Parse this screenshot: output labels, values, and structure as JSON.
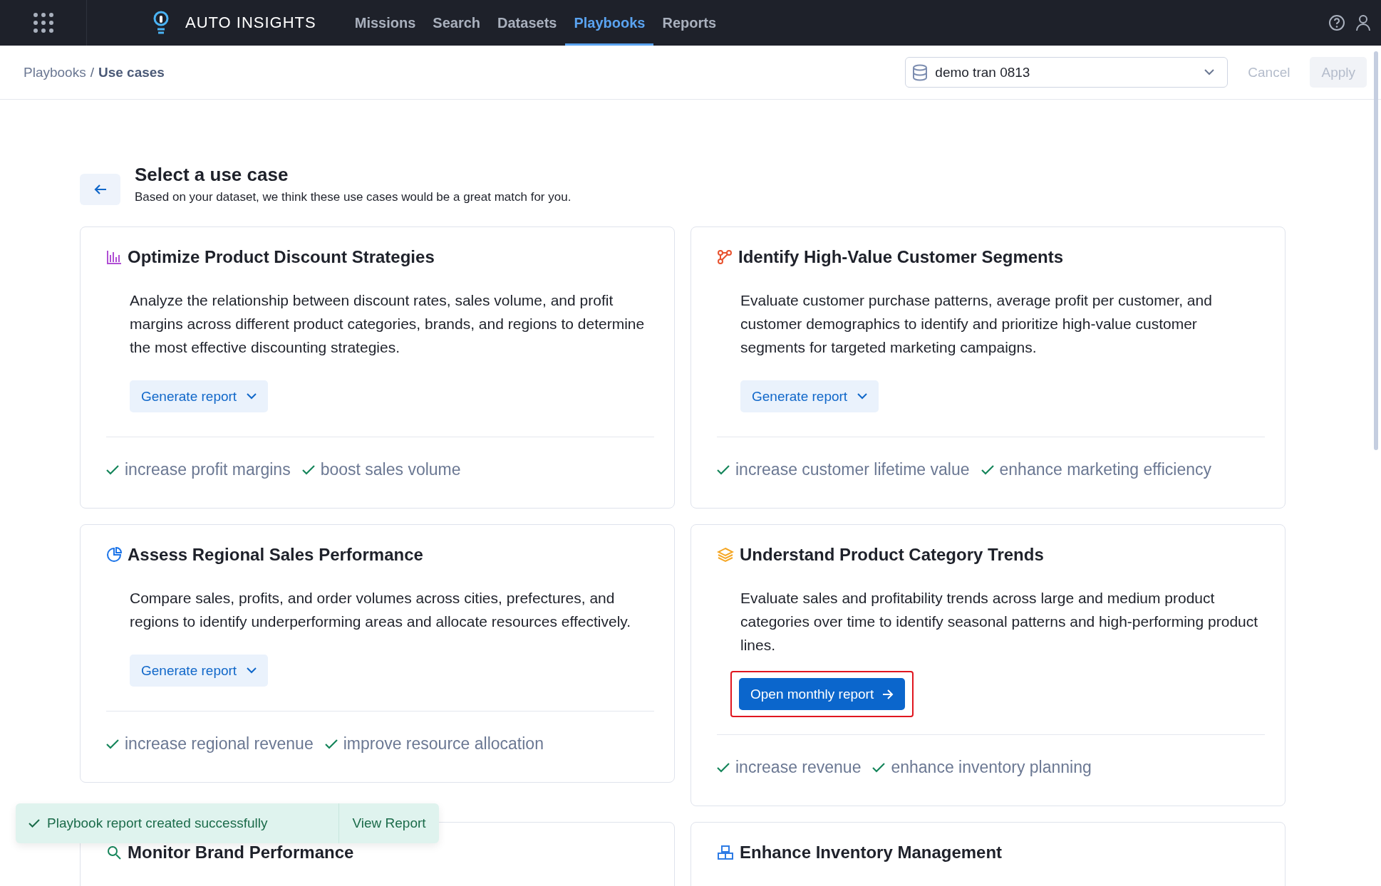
{
  "topbar": {
    "brand": "AUTO INSIGHTS",
    "nav": [
      {
        "label": "Missions",
        "selected": false
      },
      {
        "label": "Search",
        "selected": false
      },
      {
        "label": "Datasets",
        "selected": false
      },
      {
        "label": "Playbooks",
        "selected": true
      },
      {
        "label": "Reports",
        "selected": false
      }
    ]
  },
  "breadcrumb": {
    "items": [
      "Playbooks",
      "Use cases"
    ],
    "separator": "/"
  },
  "dataset_select": {
    "value": "demo tran 0813"
  },
  "actions": [
    {
      "label": "Cancel",
      "kind": "text"
    },
    {
      "label": "Apply",
      "kind": "filled"
    }
  ],
  "header": {
    "title": "Select a use case",
    "subtitle": "Based on your dataset, we think these use cases would be a great match for you."
  },
  "cards": [
    {
      "kind": "bars",
      "title": "Optimize Product Discount Strategies",
      "description": "Analyze the relationship between discount rates, sales volume, and profit margins across different product categories, brands, and regions to determine the most effective discounting strategies.",
      "action": {
        "kind": "dropdown",
        "label": "Generate report",
        "highlighted": false
      },
      "goals": [
        "increase profit margins",
        "boost sales volume"
      ]
    },
    {
      "kind": "nodes",
      "title": "Identify High-Value Customer Segments",
      "description": "Evaluate customer purchase patterns, average profit per customer, and customer demographics to identify and prioritize high-value customer segments for targeted marketing campaigns.",
      "action": {
        "kind": "dropdown",
        "label": "Generate report",
        "highlighted": false
      },
      "goals": [
        "increase customer lifetime value",
        "enhance marketing efficiency"
      ]
    },
    {
      "kind": "pie",
      "title": "Assess Regional Sales Performance",
      "description": "Compare sales, profits, and order volumes across cities, prefectures, and regions to identify underperforming areas and allocate resources effectively.",
      "action": {
        "kind": "dropdown",
        "label": "Generate report",
        "highlighted": false
      },
      "goals": [
        "increase regional revenue",
        "improve resource allocation"
      ]
    },
    {
      "kind": "layers",
      "title": "Understand Product Category Trends",
      "description": "Evaluate sales and profitability trends across large and medium product categories over time to identify seasonal patterns and high-performing product lines.",
      "action": {
        "kind": "primary",
        "label": "Open monthly report",
        "highlighted": true
      },
      "goals": [
        "increase revenue",
        "enhance inventory planning"
      ]
    },
    {
      "kind": "search",
      "title": "Monitor Brand Performance"
    },
    {
      "kind": "boxes",
      "title": "Enhance Inventory Management"
    }
  ],
  "toast": {
    "message": "Playbook report created successfully",
    "action": "View Report"
  }
}
